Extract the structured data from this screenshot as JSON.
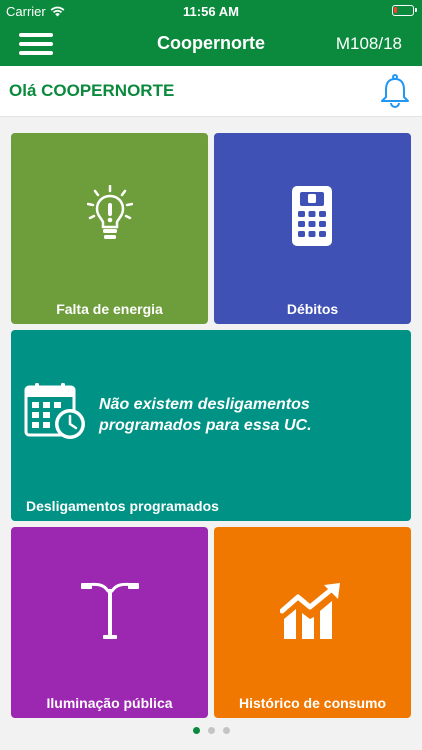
{
  "status": {
    "carrier": "Carrier",
    "time": "11:56 AM"
  },
  "nav": {
    "title": "Coopernorte",
    "code": "M108/18"
  },
  "greeting": {
    "text": "Olá COOPERNORTE"
  },
  "tiles": [
    {
      "label": "Falta de energia",
      "color": "#6e9d3b",
      "icon": "lightbulb-icon"
    },
    {
      "label": "Débitos",
      "color": "#3f51b5",
      "icon": "calculator-icon"
    },
    {
      "label": "Desligamentos programados",
      "color": "#009385",
      "icon": "calendar-clock-icon",
      "message": "Não existem desligamentos programados para essa UC."
    },
    {
      "label": "Iluminação pública",
      "color": "#9c27b0",
      "icon": "street-lamp-icon"
    },
    {
      "label": "Histórico de consumo",
      "color": "#f07800",
      "icon": "growth-chart-icon"
    }
  ],
  "pager": {
    "pages": 3,
    "active": 1
  },
  "colors": {
    "brand": "#0b8a3d",
    "bell": "#2196f3"
  }
}
